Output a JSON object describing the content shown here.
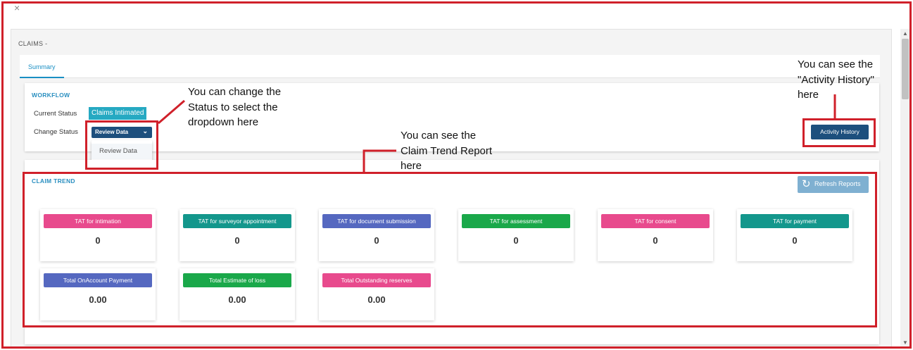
{
  "window": {
    "close_glyph": "×"
  },
  "breadcrumb": "CLAIMS -",
  "tabs": [
    {
      "label": "Summary",
      "active": true
    }
  ],
  "workflow": {
    "title": "WORKFLOW",
    "current_status_label": "Current Status",
    "current_status_value": "Claims Intimated",
    "change_status_label": "Change Status",
    "change_status_selected": "Review Data",
    "change_status_options": [
      "Review Data"
    ],
    "activity_history_button": "Activity History"
  },
  "claim_trend": {
    "title": "CLAIM TREND",
    "refresh_button": "Refresh Reports",
    "kpis": [
      {
        "label": "TAT for intimation",
        "value": "0",
        "color": "#e84a8d"
      },
      {
        "label": "TAT for surveyor appointment",
        "value": "0",
        "color": "#13978c"
      },
      {
        "label": "TAT for document submission",
        "value": "0",
        "color": "#5568c0"
      },
      {
        "label": "TAT for assessment",
        "value": "0",
        "color": "#1aa84a"
      },
      {
        "label": "TAT for consent",
        "value": "0",
        "color": "#e84a8d"
      },
      {
        "label": "TAT for payment",
        "value": "0",
        "color": "#13978c"
      },
      {
        "label": "Total OnAccount Payment",
        "value": "0.00",
        "color": "#5568c0"
      },
      {
        "label": "Total Estimate of loss",
        "value": "0.00",
        "color": "#1aa84a"
      },
      {
        "label": "Total Outstanding reserves",
        "value": "0.00",
        "color": "#e84a8d"
      }
    ]
  },
  "annotations": {
    "status_note": "You can change the\nStatus to select the\ndropdown here",
    "trend_note": "You can see the\nClaim Trend Report\nhere",
    "activity_note": "You can see the\n\"Activity History\"\nhere"
  },
  "colors": {
    "annotation_red": "#d0202a",
    "primary_button": "#1d4f7d",
    "accent_blue": "#2a8fc0"
  }
}
